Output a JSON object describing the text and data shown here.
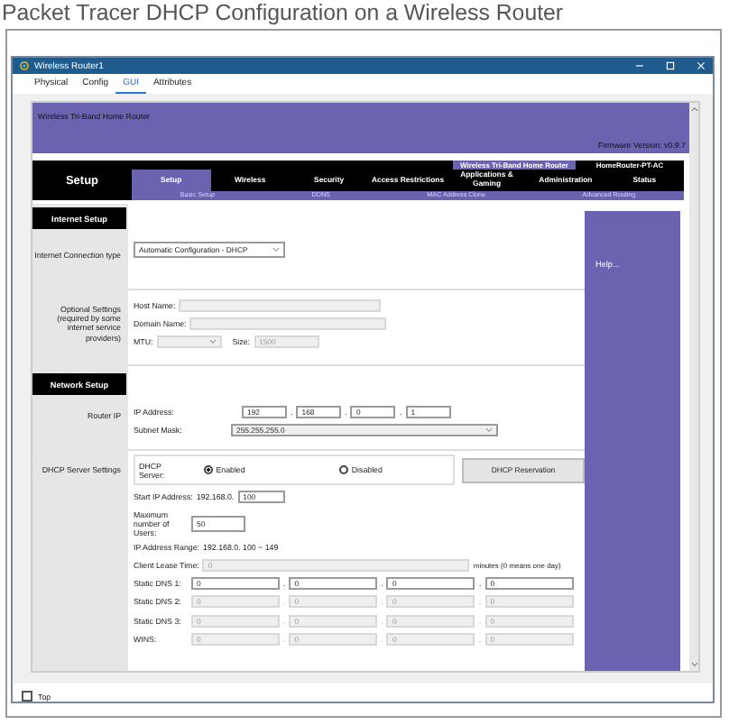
{
  "page_title": "Packet Tracer DHCP Configuration on a Wireless Router",
  "window": {
    "title": "Wireless Router1"
  },
  "tabs": [
    {
      "label": "Physical",
      "selected": false
    },
    {
      "label": "Config",
      "selected": false
    },
    {
      "label": "GUI",
      "selected": true
    },
    {
      "label": "Attributes",
      "selected": false
    }
  ],
  "router": {
    "product": "Wireless Tri-Band Home Router",
    "firmware": "Firmware Version: v0.9.7",
    "section": "Setup",
    "banner": "Wireless Tri-Band Home Router",
    "model": "HomeRouter-PT-AC",
    "nav": [
      {
        "label": "Setup",
        "selected": true
      },
      {
        "label": "Wireless",
        "selected": false
      },
      {
        "label": "Security",
        "selected": false
      },
      {
        "label": "Access Restrictions",
        "selected": false
      },
      {
        "label": "Applications & Gaming",
        "selected": false
      },
      {
        "label": "Administration",
        "selected": false
      },
      {
        "label": "Status",
        "selected": false
      }
    ],
    "subnav": [
      "Basic Setup",
      "DDNS",
      "MAC Address Clone",
      "Advanced Routing"
    ]
  },
  "help": "Help...",
  "internet_setup": {
    "heading": "Internet Setup",
    "connection_label": "Internet Connection type",
    "connection_value": "Automatic Configuration - DHCP",
    "optional_label": "Optional Settings (required by some internet service providers)",
    "host_name_label": "Host Name:",
    "domain_name_label": "Domain Name:",
    "mtu_label": "MTU:",
    "size_label": "Size:",
    "size_value": "1500"
  },
  "network_setup": {
    "heading": "Network Setup",
    "router_ip_label": "Router IP",
    "ip_label": "IP Address:",
    "ip": [
      "192",
      "168",
      "0",
      "1"
    ],
    "separator": ".",
    "subnet_label": "Subnet Mask:",
    "subnet": "255.255.255.0",
    "dhcp_label": "DHCP Server Settings",
    "dhcp_server_label": "DHCP Server:",
    "options": [
      {
        "label": "Enabled",
        "selected": true
      },
      {
        "label": "Disabled",
        "selected": false
      }
    ],
    "reservation": "DHCP Reservation",
    "start_label": "Start IP Address:",
    "start_prefix": "192.168.0.",
    "start_value": "100",
    "max_label": "Maximum number of Users:",
    "max_value": "50",
    "range_label": "IP Address Range:",
    "range": "192.168.0. 100 ~ 149",
    "lease_label": "Client Lease Time:",
    "lease_value": "0",
    "lease_unit": "minutes (0 means one day)",
    "dns": [
      {
        "label": "Static DNS 1:",
        "values": [
          "0",
          "0",
          "0",
          "0"
        ],
        "disabled": false
      },
      {
        "label": "Static DNS 2:",
        "values": [
          "0",
          "0",
          "0",
          "0"
        ],
        "disabled": true
      },
      {
        "label": "Static DNS 3:",
        "values": [
          "0",
          "0",
          "0",
          "0"
        ],
        "disabled": true
      },
      {
        "label": "WINS:",
        "values": [
          "0",
          "0",
          "0",
          "0"
        ],
        "disabled": true
      }
    ]
  },
  "top_checkbox": {
    "label": "Top",
    "checked": false
  }
}
